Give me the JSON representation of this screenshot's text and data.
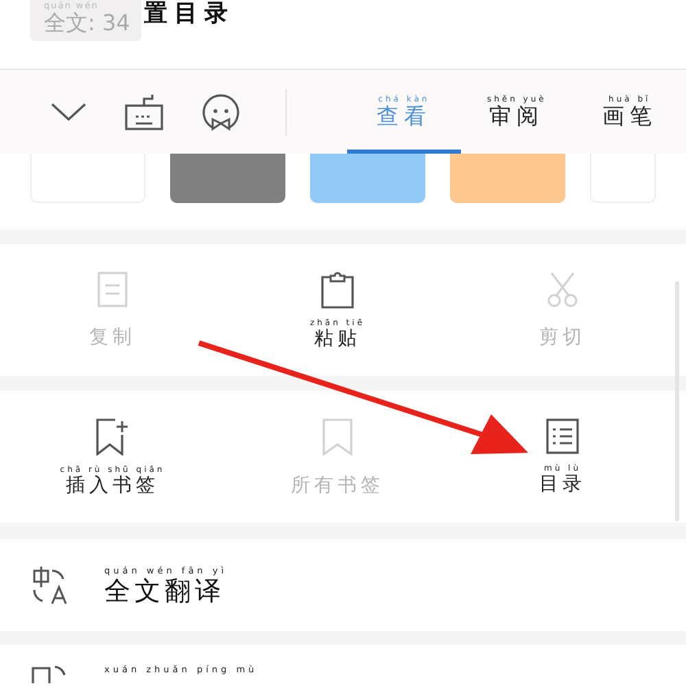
{
  "header": {
    "count_pill": {
      "pinyin": "quán wén",
      "label": "全文: 34"
    },
    "title": "置目录"
  },
  "toolbar": {
    "tabs": [
      {
        "label": "查看",
        "pinyin": "chá kàn",
        "selected": true
      },
      {
        "label": "审阅",
        "pinyin": "shěn yuè",
        "selected": false
      },
      {
        "label": "画笔",
        "pinyin": "huà bǐ",
        "selected": false
      }
    ]
  },
  "color_cards": [
    {
      "color": "#ffffff"
    },
    {
      "color": "#808080"
    },
    {
      "color": "#92c9f7"
    },
    {
      "color": "#fcc890"
    },
    {
      "color": "#ffffff"
    }
  ],
  "sections": [
    {
      "items": [
        {
          "label": "复制",
          "disabled": true
        },
        {
          "label": "粘贴",
          "pinyin": "zhān tiē",
          "disabled": false
        },
        {
          "label": "剪切",
          "disabled": true
        }
      ]
    },
    {
      "items": [
        {
          "label": "插入书签",
          "pinyin": "chā rù shū qiān",
          "disabled": false
        },
        {
          "label": "所有书签",
          "disabled": true
        },
        {
          "label": "目录",
          "pinyin": "mù lù",
          "disabled": false
        }
      ]
    }
  ],
  "rows": [
    {
      "label": "全文翻译",
      "pinyin": "quán wén fān yì"
    },
    {
      "pinyin": "xuán zhuǎn píng mù"
    }
  ]
}
